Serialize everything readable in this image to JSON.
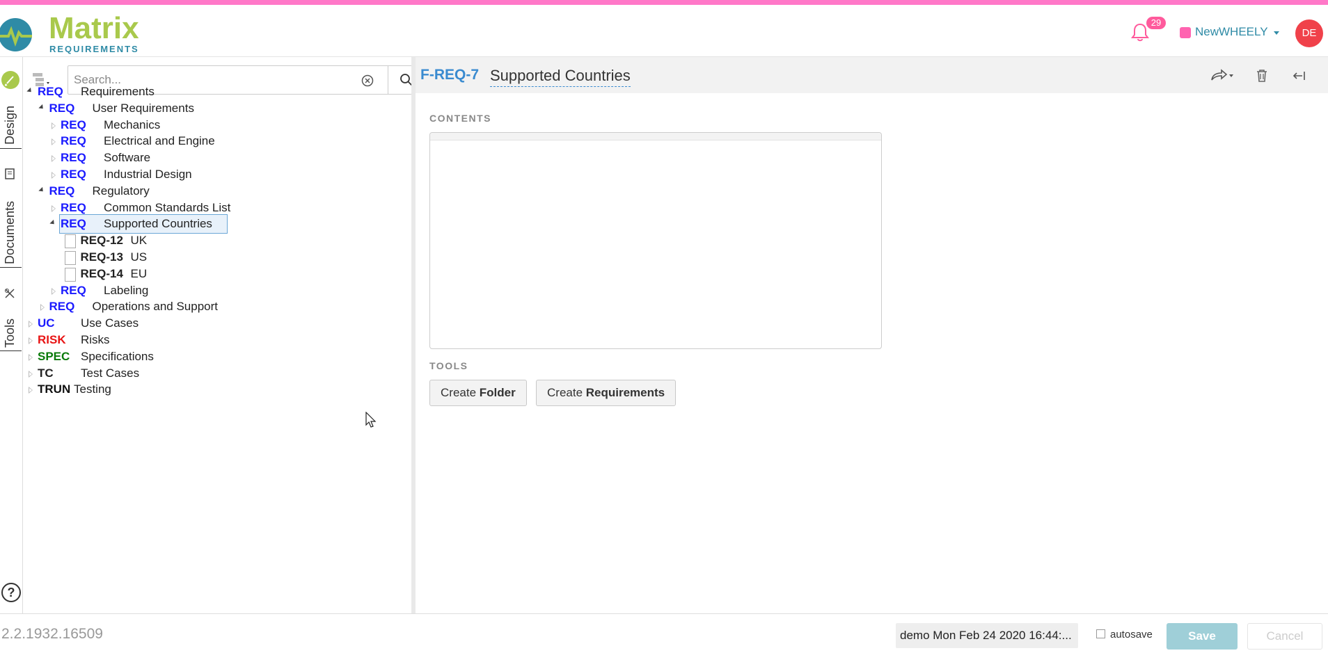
{
  "app": {
    "logo_text": "Matrix",
    "logo_sub": "REQUIREMENTS",
    "notifications_count": "29",
    "project_name": "NewWHEELY",
    "user_initials": "DE",
    "colors": {
      "accent_top": "#ff78c8",
      "brand_green": "#a9c94c",
      "brand_blue": "#2f8ba6",
      "avatar": "#f0414a",
      "req_blue": "#1a1aff",
      "risk_red": "#e81414",
      "spec_green": "#0a7a0a"
    }
  },
  "left_rail": {
    "tabs": [
      "Design",
      "Documents",
      "Tools"
    ],
    "help_label": "?"
  },
  "search": {
    "placeholder": "Search..."
  },
  "tree": {
    "rows": [
      {
        "cat": "REQ",
        "label": "Requirements"
      },
      {
        "cat": "REQ",
        "label": "User Requirements"
      },
      {
        "cat": "REQ",
        "label": "Mechanics"
      },
      {
        "cat": "REQ",
        "label": "Electrical and Engine"
      },
      {
        "cat": "REQ",
        "label": "Software"
      },
      {
        "cat": "REQ",
        "label": "Industrial Design"
      },
      {
        "cat": "REQ",
        "label": "Regulatory"
      },
      {
        "cat": "REQ",
        "label": "Common Standards List"
      },
      {
        "cat": "REQ",
        "label": "Supported Countries"
      },
      {
        "cat": "REQ-12",
        "label": "UK"
      },
      {
        "cat": "REQ-13",
        "label": "US"
      },
      {
        "cat": "REQ-14",
        "label": "EU"
      },
      {
        "cat": "REQ",
        "label": "Labeling"
      },
      {
        "cat": "REQ",
        "label": "Operations and Support"
      },
      {
        "cat": "UC",
        "label": "Use Cases"
      },
      {
        "cat": "RISK",
        "label": "Risks"
      },
      {
        "cat": "SPEC",
        "label": "Specifications"
      },
      {
        "cat": "TC",
        "label": "Test Cases"
      },
      {
        "cat": "TRUN",
        "label": "Testing"
      }
    ]
  },
  "detail": {
    "item_id": "F-REQ-7",
    "item_title": "Supported Countries",
    "contents_label": "CONTENTS",
    "tools_label": "TOOLS",
    "create_folder_prefix": "Create ",
    "create_folder_bold": "Folder",
    "create_req_prefix": "Create ",
    "create_req_bold": "Requirements"
  },
  "footer": {
    "version": "2.2.1932.16509",
    "status": "demo Mon Feb 24 2020 16:44:...",
    "autosave_label": "autosave",
    "save_label": "Save",
    "cancel_label": "Cancel"
  }
}
